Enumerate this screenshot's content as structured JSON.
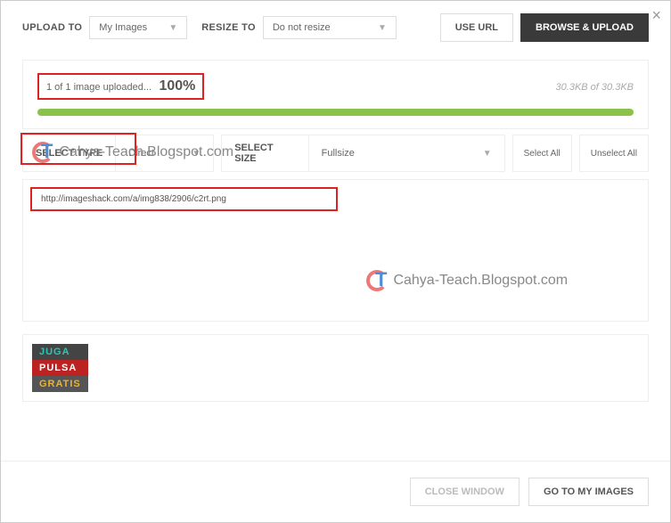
{
  "toolbar": {
    "upload_to_label": "UPLOAD TO",
    "upload_to_value": "My Images",
    "resize_to_label": "RESIZE TO",
    "resize_to_value": "Do not resize",
    "use_url_label": "USE URL",
    "browse_upload_label": "BROWSE & UPLOAD"
  },
  "progress": {
    "status_text": "1 of 1 image uploaded...",
    "percent": "100%",
    "size_text": "30.3KB of 30.3KB"
  },
  "select_row": {
    "type_label": "SELECT TYPE",
    "type_value": "Direct",
    "size_label": "SELECT SIZE",
    "size_value": "Fullsize",
    "select_all_label": "Select All",
    "unselect_all_label": "Unselect All"
  },
  "link": {
    "url": "http://imageshack.com/a/img838/2906/c2rt.png"
  },
  "ad": {
    "line1": "JUGA",
    "line2": "PULSA",
    "line3": "GRATIS"
  },
  "footer": {
    "close_label": "CLOSE WINDOW",
    "goto_label": "GO TO MY IMAGES"
  },
  "watermark": {
    "text": "Cahya-Teach.Blogspot.com"
  }
}
